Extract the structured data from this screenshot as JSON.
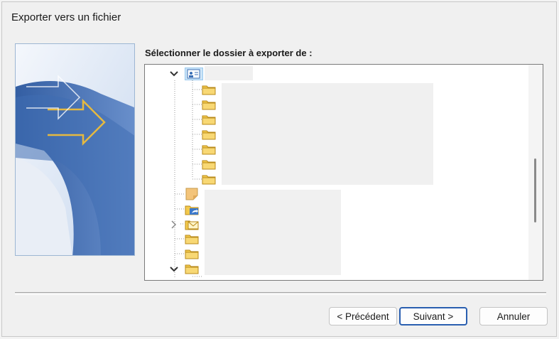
{
  "window": {
    "title": "Exporter vers un fichier"
  },
  "prompt": "Sélectionner le dossier à exporter de :",
  "tree": {
    "icons": [
      "contacts-icon",
      "folder-icon",
      "folder-icon",
      "folder-icon",
      "folder-icon",
      "folder-icon",
      "folder-icon",
      "folder-icon",
      "folder-icon",
      "folder-icon",
      "mail-folder-icon",
      "folder-icon",
      "folder-icon",
      "folder-icon"
    ],
    "names_redacted": true
  },
  "buttons": {
    "back": "< Précédent",
    "next": "Suivant >",
    "cancel": "Annuler"
  },
  "colors": {
    "accent": "#2a5fb0",
    "folder": "#e8b63a",
    "banner_blue": "#2b5aa0"
  }
}
